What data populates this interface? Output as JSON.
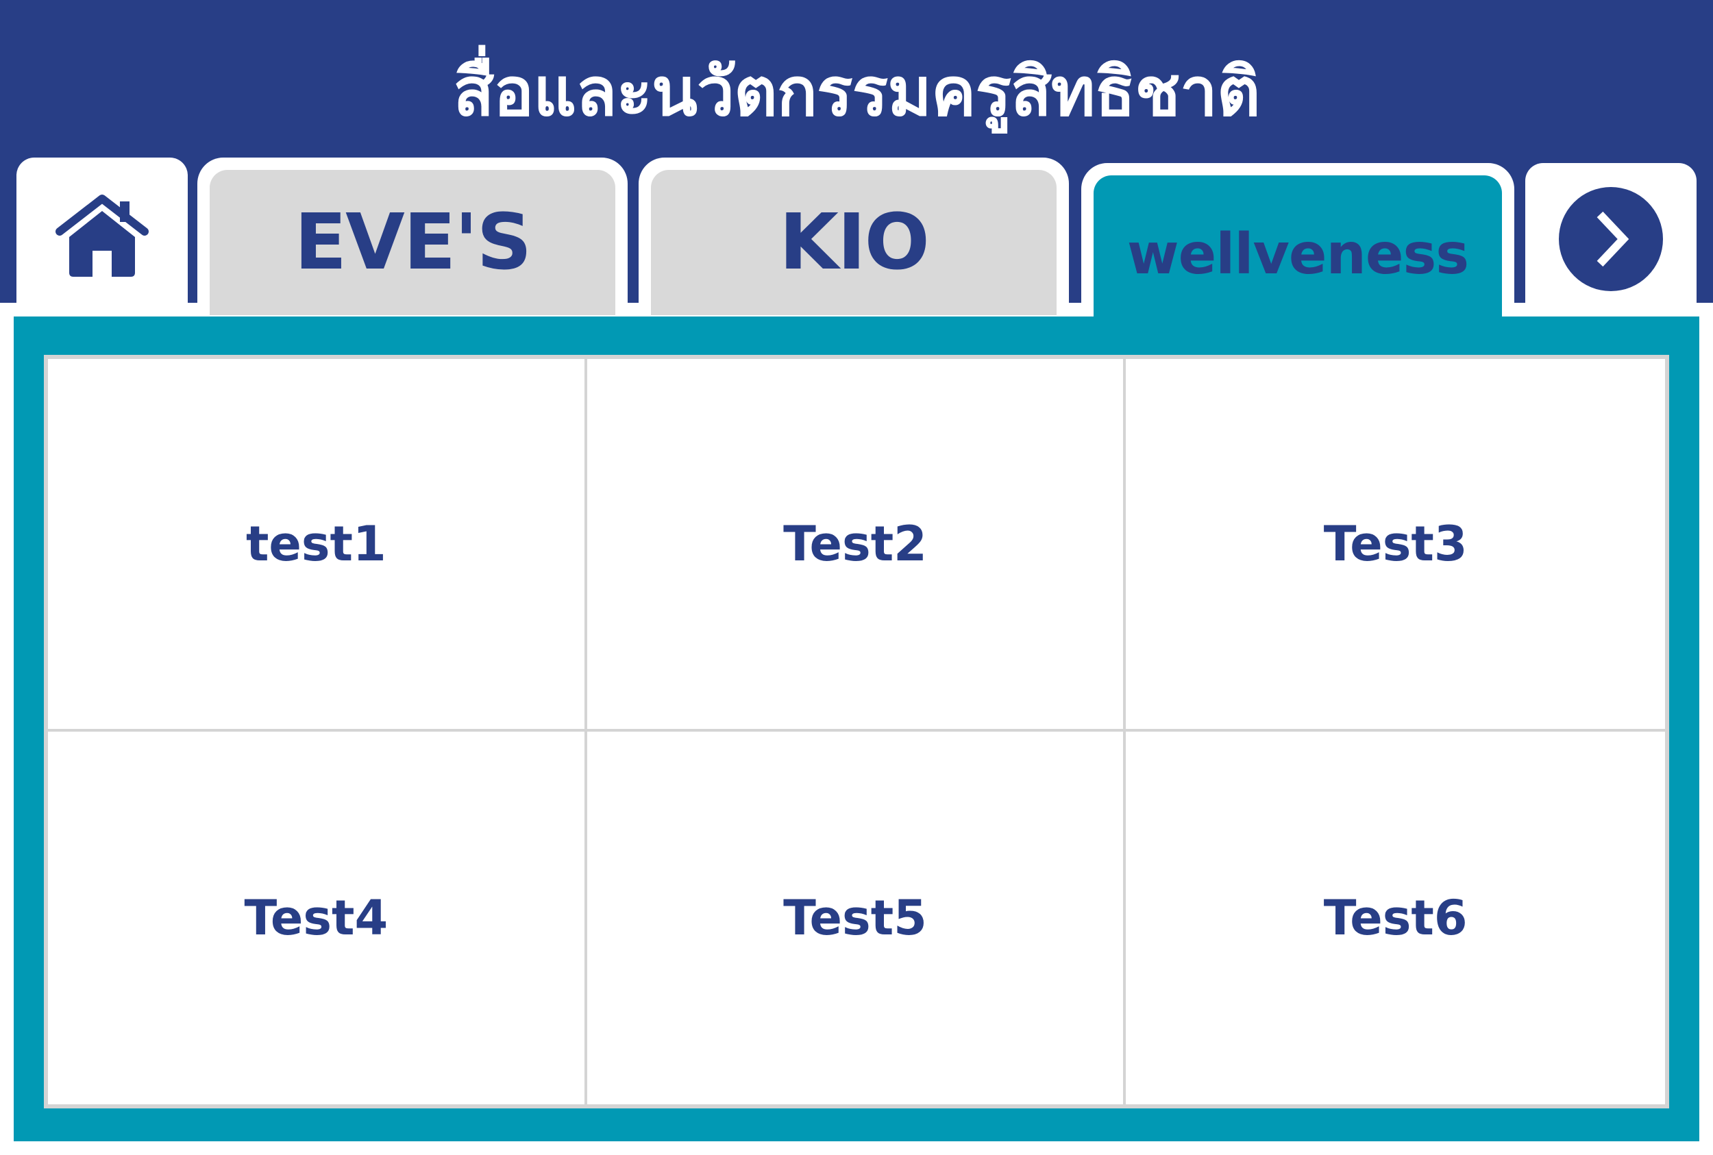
{
  "header": {
    "title": "สื่อและนวัตกรรมครูสิทธิชาติ"
  },
  "nav": {
    "home_icon": "home-icon",
    "next_icon": "chevron-right-circle-icon",
    "tabs": [
      {
        "label": "EVE'S",
        "active": false
      },
      {
        "label": "KIO",
        "active": false
      },
      {
        "label": "wellveness",
        "active": true
      }
    ]
  },
  "content": {
    "cells": [
      "test1",
      "Test2",
      "Test3",
      "Test4",
      "Test5",
      "Test6"
    ]
  },
  "colors": {
    "header_bg": "#283e86",
    "accent": "#0199b4",
    "inactive_tab": "#d9d9d9",
    "text": "#283e86",
    "grid_line": "#d4d4d4"
  }
}
